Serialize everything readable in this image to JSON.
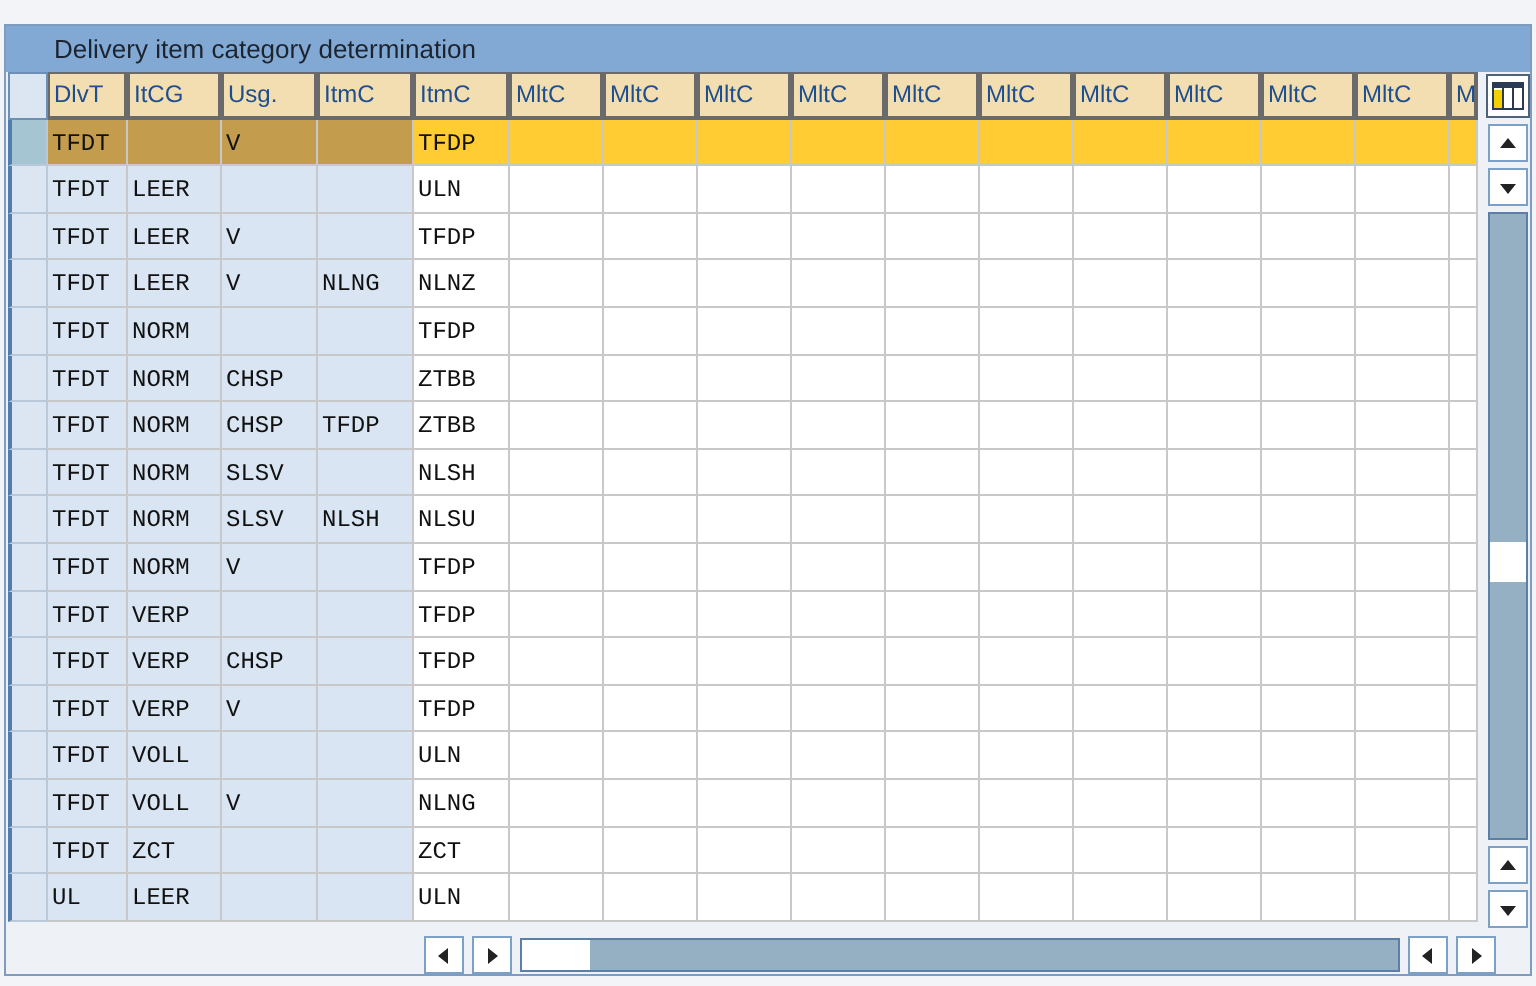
{
  "panel": {
    "title": "Delivery item category determination"
  },
  "table": {
    "columns": [
      {
        "label": "DlvT",
        "key": true
      },
      {
        "label": "ItCG",
        "key": true
      },
      {
        "label": "Usg.",
        "key": true
      },
      {
        "label": "ItmC",
        "key": true
      },
      {
        "label": "ItmC",
        "key": false
      },
      {
        "label": "MltC",
        "key": false
      },
      {
        "label": "MltC",
        "key": false
      },
      {
        "label": "MltC",
        "key": false
      },
      {
        "label": "MltC",
        "key": false
      },
      {
        "label": "MltC",
        "key": false
      },
      {
        "label": "MltC",
        "key": false
      },
      {
        "label": "MltC",
        "key": false
      },
      {
        "label": "MltC",
        "key": false
      },
      {
        "label": "MltC",
        "key": false
      },
      {
        "label": "MltC",
        "key": false
      },
      {
        "label": "M",
        "key": false
      }
    ],
    "rows": [
      {
        "selected": true,
        "cells": [
          "TFDT",
          null,
          "V",
          null,
          "TFDP"
        ]
      },
      {
        "selected": false,
        "cells": [
          "TFDT",
          "LEER",
          null,
          null,
          "ULN"
        ]
      },
      {
        "selected": false,
        "cells": [
          "TFDT",
          "LEER",
          "V",
          null,
          "TFDP"
        ]
      },
      {
        "selected": false,
        "cells": [
          "TFDT",
          "LEER",
          "V",
          "NLNG",
          "NLNZ"
        ]
      },
      {
        "selected": false,
        "cells": [
          "TFDT",
          "NORM",
          null,
          null,
          "TFDP"
        ]
      },
      {
        "selected": false,
        "cells": [
          "TFDT",
          "NORM",
          "CHSP",
          null,
          "ZTBB"
        ]
      },
      {
        "selected": false,
        "cells": [
          "TFDT",
          "NORM",
          "CHSP",
          "TFDP",
          "ZTBB"
        ]
      },
      {
        "selected": false,
        "cells": [
          "TFDT",
          "NORM",
          "SLSV",
          null,
          "NLSH"
        ]
      },
      {
        "selected": false,
        "cells": [
          "TFDT",
          "NORM",
          "SLSV",
          "NLSH",
          "NLSU"
        ]
      },
      {
        "selected": false,
        "cells": [
          "TFDT",
          "NORM",
          "V",
          null,
          "TFDP"
        ]
      },
      {
        "selected": false,
        "cells": [
          "TFDT",
          "VERP",
          null,
          null,
          "TFDP"
        ]
      },
      {
        "selected": false,
        "cells": [
          "TFDT",
          "VERP",
          "CHSP",
          null,
          "TFDP"
        ]
      },
      {
        "selected": false,
        "cells": [
          "TFDT",
          "VERP",
          "V",
          null,
          "TFDP"
        ]
      },
      {
        "selected": false,
        "cells": [
          "TFDT",
          "VOLL",
          null,
          null,
          "ULN"
        ]
      },
      {
        "selected": false,
        "cells": [
          "TFDT",
          "VOLL",
          "V",
          null,
          "NLNG"
        ]
      },
      {
        "selected": false,
        "cells": [
          "TFDT",
          "ZCT",
          null,
          null,
          "ZCT"
        ]
      },
      {
        "selected": false,
        "cells": [
          "UL",
          "LEER",
          null,
          null,
          "ULN"
        ]
      }
    ]
  }
}
